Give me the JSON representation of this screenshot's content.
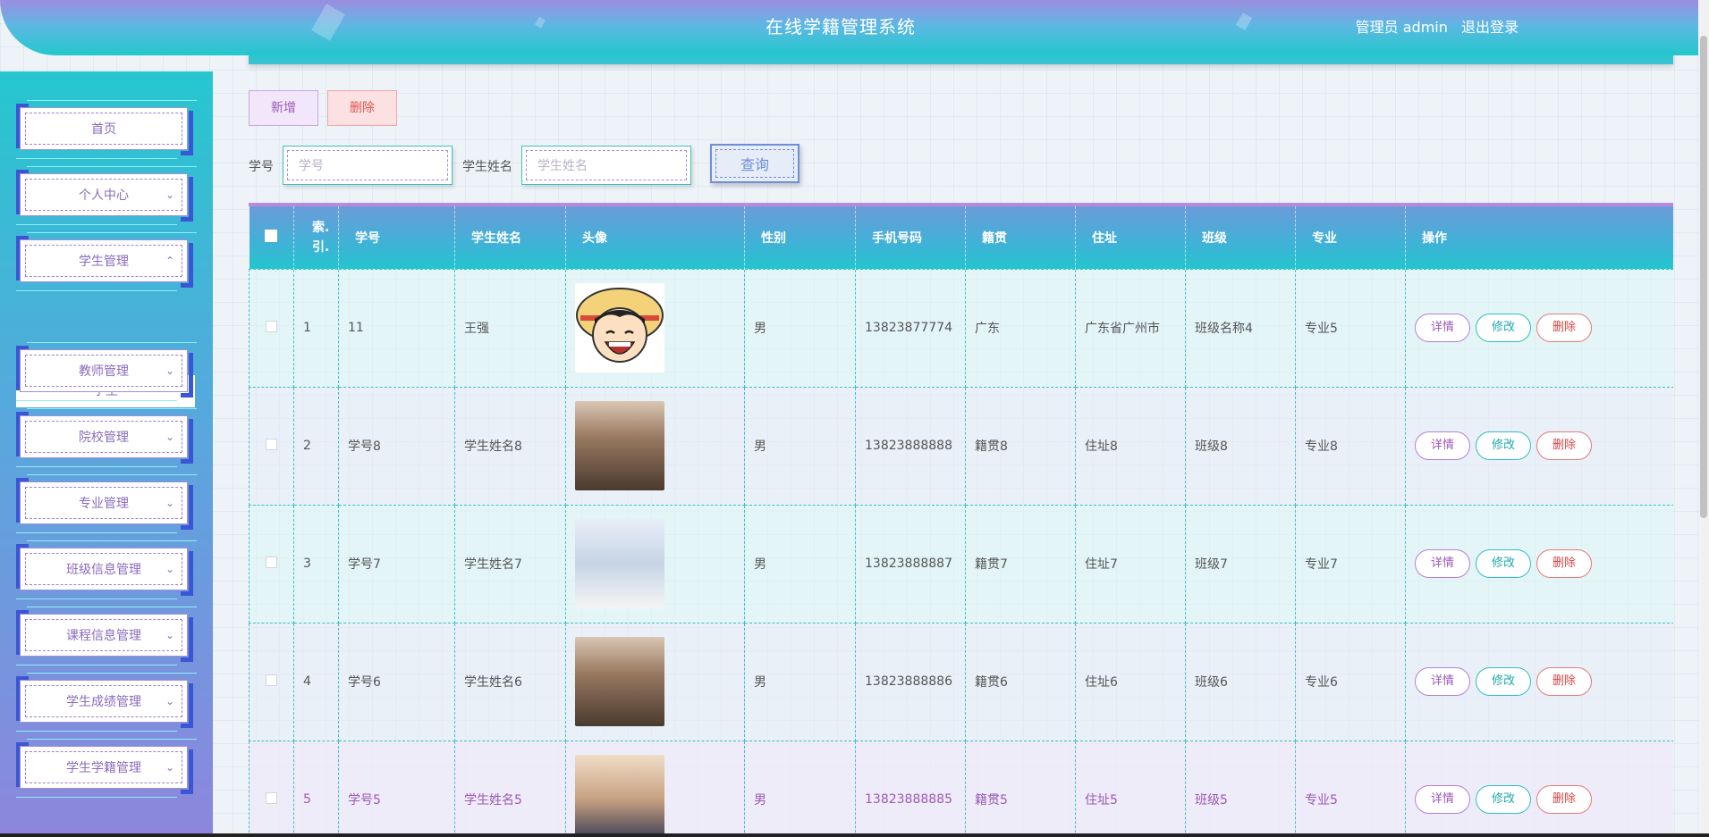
{
  "header": {
    "title": "在线学籍管理系统",
    "role_user": "管理员 admin",
    "logout": "退出登录"
  },
  "sidebar": {
    "items": [
      {
        "label": "首页",
        "arrow": ""
      },
      {
        "label": "个人中心",
        "arrow": "chevron-down"
      },
      {
        "label": "学生管理",
        "arrow": "chevron-up"
      },
      {
        "label": "教师管理",
        "arrow": "chevron-down"
      },
      {
        "label": "院校管理",
        "arrow": "chevron-down"
      },
      {
        "label": "专业管理",
        "arrow": "chevron-down"
      },
      {
        "label": "班级信息管理",
        "arrow": "chevron-down"
      },
      {
        "label": "课程信息管理",
        "arrow": "chevron-down"
      },
      {
        "label": "学生成绩管理",
        "arrow": "chevron-down"
      },
      {
        "label": "学生学籍管理",
        "arrow": "chevron-down"
      }
    ],
    "submenu_active": "学生"
  },
  "toolbar": {
    "add_label": "新增",
    "delete_label": "删除"
  },
  "search": {
    "student_no_label": "学号",
    "student_no_placeholder": "学号",
    "student_name_label": "学生姓名",
    "student_name_placeholder": "学生姓名",
    "query_label": "查询"
  },
  "table": {
    "columns": [
      "索引",
      "学号",
      "学生姓名",
      "头像",
      "性别",
      "手机号码",
      "籍贯",
      "住址",
      "班级",
      "专业",
      "操作"
    ],
    "index_header_line1": "索.",
    "index_header_line2": "引.",
    "rows": [
      {
        "index": "1",
        "student_no": "11",
        "name": "王强",
        "avatar": "cartoon-straw-hat-avatar",
        "gender": "男",
        "phone": "13823877774",
        "native": "广东",
        "address": "广东省广州市",
        "class": "班级名称4",
        "major": "专业5"
      },
      {
        "index": "2",
        "student_no": "学号8",
        "name": "学生姓名8",
        "avatar": "portrait-photo",
        "gender": "男",
        "phone": "13823888888",
        "native": "籍贯8",
        "address": "住址8",
        "class": "班级8",
        "major": "专业8"
      },
      {
        "index": "3",
        "student_no": "学号7",
        "name": "学生姓名7",
        "avatar": "portrait-photo",
        "gender": "男",
        "phone": "13823888887",
        "native": "籍贯7",
        "address": "住址7",
        "class": "班级7",
        "major": "专业7"
      },
      {
        "index": "4",
        "student_no": "学号6",
        "name": "学生姓名6",
        "avatar": "portrait-photo",
        "gender": "男",
        "phone": "13823888886",
        "native": "籍贯6",
        "address": "住址6",
        "class": "班级6",
        "major": "专业6"
      },
      {
        "index": "5",
        "student_no": "学号5",
        "name": "学生姓名5",
        "avatar": "portrait-photo",
        "gender": "男",
        "phone": "13823888885",
        "native": "籍贯5",
        "address": "住址5",
        "class": "班级5",
        "major": "专业5"
      }
    ],
    "actions": {
      "detail": "详情",
      "edit": "修改",
      "delete": "删除"
    }
  },
  "colors": {
    "header_gradient_top": "#9c8de0",
    "header_gradient_bottom": "#22c8cc",
    "accent_purple": "#9b59b6",
    "accent_teal": "#1fa8ac",
    "accent_red": "#d94444"
  }
}
